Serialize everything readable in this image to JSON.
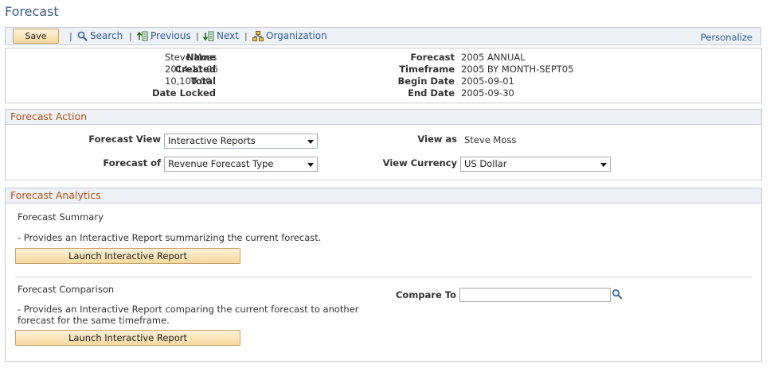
{
  "page": {
    "title": "Forecast"
  },
  "toolbar": {
    "save_label": "Save",
    "separator": "|",
    "search_label": "Search",
    "previous_label": "Previous",
    "next_label": "Next",
    "organization_label": "Organization",
    "personalize_label": "Personalize"
  },
  "header": {
    "name_label": "Name",
    "name_value": "Steve Moss",
    "created_label": "Created",
    "created_value": "2014-11-06",
    "total_label": "Total",
    "total_value": "10,100.00",
    "date_locked_label": "Date Locked",
    "forecast_label": "Forecast",
    "forecast_value": "2005 ANNUAL",
    "timeframe_label": "Timeframe",
    "timeframe_value": "2005 BY MONTH-SEPT05",
    "begin_date_label": "Begin Date",
    "begin_date_value": "2005-09-01",
    "end_date_label": "End Date",
    "end_date_value": "2005-09-30"
  },
  "forecast_action": {
    "title": "Forecast Action",
    "forecast_view_label": "Forecast View",
    "forecast_view_value": "Interactive Reports",
    "forecast_of_label": "Forecast of",
    "forecast_of_value": "Revenue Forecast Type",
    "view_as_label": "View as",
    "view_as_value": "Steve Moss",
    "view_currency_label": "View Currency",
    "view_currency_value": "US Dollar"
  },
  "analytics": {
    "title": "Forecast Analytics",
    "summary_title": "Forecast Summary",
    "summary_desc": "- Provides an Interactive Report summarizing the current forecast.",
    "summary_button": "Launch Interactive Report",
    "comparison_title": "Forecast Comparison",
    "comparison_desc_line1": "- Provides an Interactive Report comparing the current forecast to another",
    "comparison_desc_line2": "forecast for the same timeframe.",
    "compare_to_label": "Compare To",
    "compare_to_value": "",
    "comparison_button": "Launch Interactive Report"
  },
  "colors": {
    "link": "#2e5c9a",
    "section_title": "#b5531a",
    "button_fill": "#f6d99f",
    "title": "#3e5a8a"
  },
  "icons": [
    "search-icon",
    "previous-icon",
    "next-icon",
    "organization-icon",
    "lookup-icon",
    "chevron-down-icon"
  ]
}
